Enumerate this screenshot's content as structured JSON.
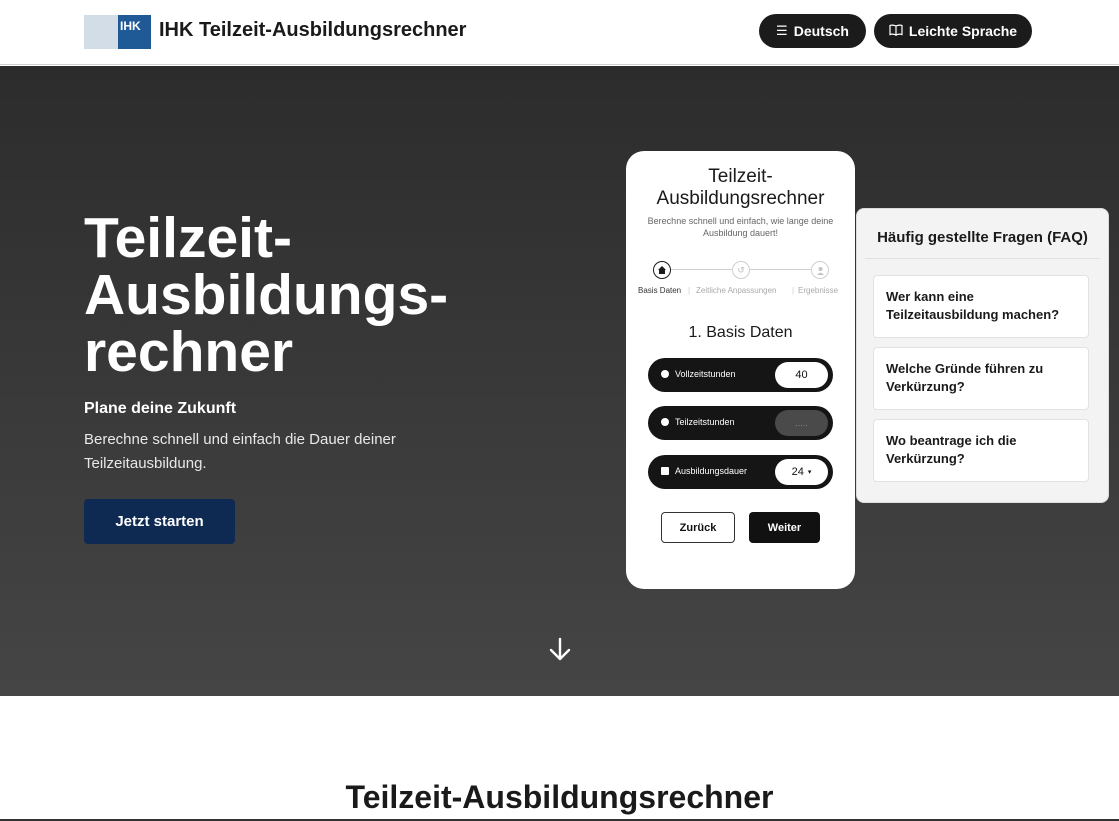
{
  "header": {
    "logo_text": "IHK",
    "title": "IHK Teilzeit-Ausbildungsrechner",
    "language_button": "Deutsch",
    "easy_language_button": "Leichte Sprache"
  },
  "hero": {
    "title_lines": [
      "Teilzeit-",
      "Ausbildungs-",
      "rechner"
    ],
    "subtitle": "Plane deine Zukunft",
    "text": "Berechne schnell und einfach die Dauer deiner Teilzeitausbildung.",
    "cta": "Jetzt starten",
    "scroll_icon": "arrow-down-icon"
  },
  "calculator": {
    "title_lines": [
      "Teilzeit-",
      "Ausbildungsrechner"
    ],
    "description": "Berechne schnell und einfach, wie lange deine Ausbildung dauert!",
    "steps": [
      {
        "label": "Basis Daten",
        "icon": "home-icon",
        "active": true
      },
      {
        "label": "Zeitliche Anpassungen",
        "icon": "history-icon",
        "active": false
      },
      {
        "label": "Ergebnisse",
        "icon": "user-icon",
        "active": false
      }
    ],
    "section_title": "1. Basis Daten",
    "fields": [
      {
        "label": "Vollzeitstunden",
        "value": "40",
        "icon": "clock-icon"
      },
      {
        "label": "Teilzeitstunden",
        "value": ".....",
        "icon": "clock-icon"
      },
      {
        "label": "Ausbildungsdauer",
        "value": "24",
        "icon": "calendar-icon"
      }
    ],
    "back_button": "Zurück",
    "next_button": "Weiter"
  },
  "faq": {
    "title": "Häufig gestellte Fragen (FAQ)",
    "items": [
      "Wer kann eine Teilzeitausbildung machen?",
      "Welche Gründe führen zu Verkürzung?",
      "Wo beantrage ich die Verkürzung?"
    ]
  },
  "section": {
    "title": "Teilzeit-Ausbildungsrechner"
  },
  "colors": {
    "brand_blue": "#1f5a97",
    "cta_navy": "#0e2a52",
    "hero_dark": "#333333"
  }
}
